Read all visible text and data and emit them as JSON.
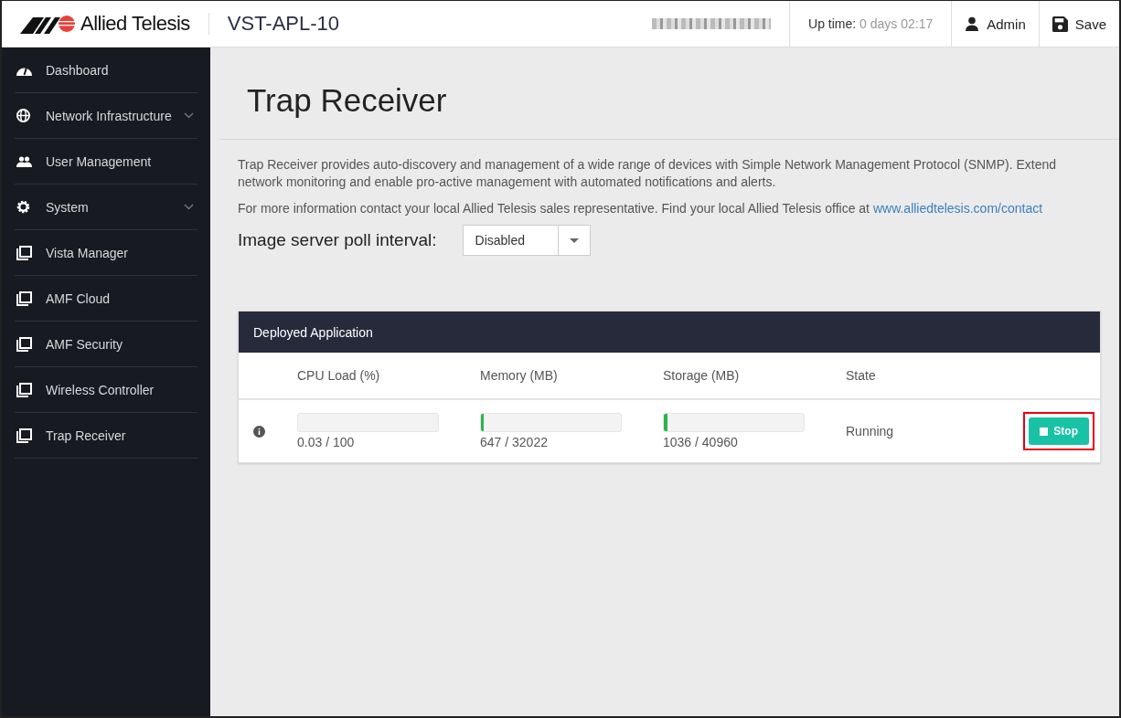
{
  "header": {
    "brand": "Allied Telesis",
    "device": "VST-APL-10",
    "uptime_label": "Up time:",
    "uptime_value": "0 days 02:17",
    "user": "Admin",
    "save": "Save"
  },
  "sidebar": {
    "items": [
      {
        "label": "Dashboard",
        "kind": "gauge",
        "expandable": false
      },
      {
        "label": "Network Infrastructure",
        "kind": "globe",
        "expandable": true
      },
      {
        "label": "User Management",
        "kind": "users",
        "expandable": false
      },
      {
        "label": "System",
        "kind": "gear",
        "expandable": true
      },
      {
        "label": "Vista Manager",
        "kind": "window",
        "expandable": false
      },
      {
        "label": "AMF Cloud",
        "kind": "window",
        "expandable": false
      },
      {
        "label": "AMF Security",
        "kind": "window",
        "expandable": false
      },
      {
        "label": "Wireless Controller",
        "kind": "window",
        "expandable": false
      },
      {
        "label": "Trap Receiver",
        "kind": "window",
        "expandable": false
      }
    ]
  },
  "page": {
    "title": "Trap Receiver",
    "description": "Trap Receiver provides auto-discovery and management of a wide range of devices with Simple Network Management Protocol (SNMP). Extend network monitoring and enable pro-active management with automated notifications and alerts.",
    "contact_text": "For more information contact your local Allied Telesis sales representative. Find your local Allied Telesis office at ",
    "contact_link": "www.alliedtelesis.com/contact",
    "poll_label": "Image server poll interval:",
    "poll_value": "Disabled"
  },
  "panel": {
    "title": "Deployed Application",
    "columns": [
      "CPU Load (%)",
      "Memory (MB)",
      "Storage (MB)",
      "State"
    ],
    "row": {
      "meters": [
        {
          "level": 0.0003,
          "reading": "0.03 / 100"
        },
        {
          "level": 0.02,
          "reading": "647 / 32022"
        },
        {
          "level": 0.025,
          "reading": "1036 / 40960"
        }
      ],
      "state": "Running",
      "button": "Stop",
      "highlighted": true
    }
  }
}
